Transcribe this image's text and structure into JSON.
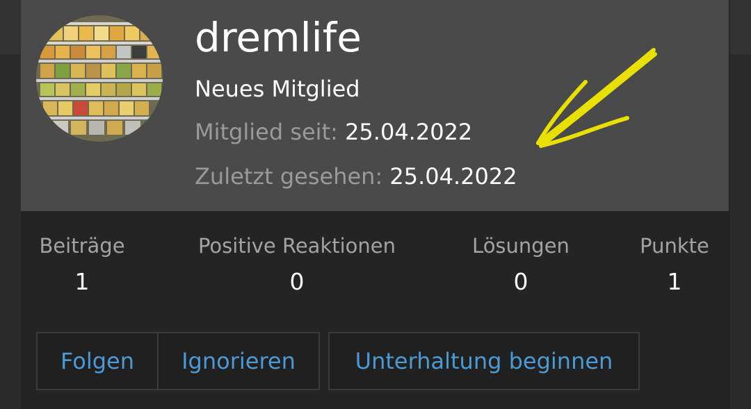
{
  "profile": {
    "username": "dremlife",
    "rank": "Neues Mitglied",
    "joined_label": "Mitglied seit:",
    "joined_value": "25.04.2022",
    "last_seen_label": "Zuletzt gesehen:",
    "last_seen_value": "25.04.2022"
  },
  "stats": [
    {
      "label": "Beiträge",
      "value": "1"
    },
    {
      "label": "Positive Reaktionen",
      "value": "0"
    },
    {
      "label": "Lösungen",
      "value": "0"
    },
    {
      "label": "Punkte",
      "value": "1"
    }
  ],
  "actions": {
    "follow": "Folgen",
    "ignore": "Ignorieren",
    "conversation": "Unterhaltung beginnen"
  },
  "colors": {
    "link": "#4a9ad6",
    "header_bg": "#4a4a4a",
    "card_bg": "#242424",
    "annotation_arrow": "#e8e000"
  }
}
